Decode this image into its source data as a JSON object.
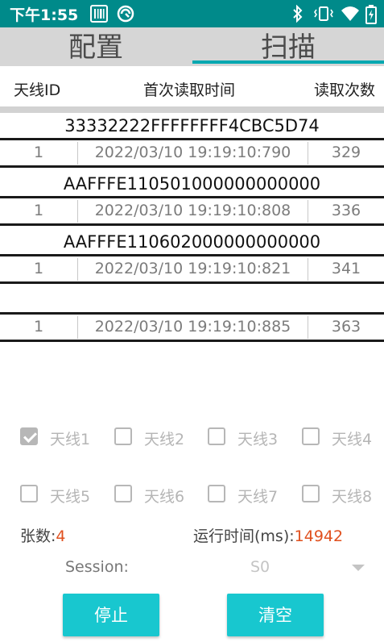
{
  "status_bar": {
    "time": "下午1:55",
    "left_icons": [
      "barcode-icon",
      "scan-app-icon"
    ],
    "right_icons": [
      "bluetooth-icon",
      "vibrate-icon",
      "wifi-icon",
      "battery-icon"
    ],
    "background": "#008a8a"
  },
  "tabs": [
    {
      "label": "配置",
      "selected": false
    },
    {
      "label": "扫描",
      "selected": true
    }
  ],
  "accent_color": "#00a8b0",
  "table_header": {
    "antenna_id": "天线ID",
    "first_read_time": "首次读取时间",
    "read_count": "读取次数"
  },
  "tags": [
    {
      "epc": "33332222FFFFFFFF4CBC5D74",
      "antenna": "1",
      "time": "2022/03/10 19:19:10:790",
      "count": "329"
    },
    {
      "epc": "AAFFFE110501000000000000",
      "antenna": "1",
      "time": "2022/03/10 19:19:10:808",
      "count": "336"
    },
    {
      "epc": "AAFFFE110602000000000000",
      "antenna": "1",
      "time": "2022/03/10 19:19:10:821",
      "count": "341"
    },
    {
      "epc": "",
      "antenna": "1",
      "time": "2022/03/10 19:19:10:885",
      "count": "363"
    }
  ],
  "antennas": [
    {
      "label": "天线1",
      "checked": true
    },
    {
      "label": "天线2",
      "checked": false
    },
    {
      "label": "天线3",
      "checked": false
    },
    {
      "label": "天线4",
      "checked": false
    },
    {
      "label": "天线5",
      "checked": false
    },
    {
      "label": "天线6",
      "checked": false
    },
    {
      "label": "天线7",
      "checked": false
    },
    {
      "label": "天线8",
      "checked": false
    }
  ],
  "stats": {
    "count_label": "张数:",
    "count_value": "4",
    "runtime_label": "运行时间(ms):",
    "runtime_value": "14942",
    "value_color": "#e0501e"
  },
  "session": {
    "label": "Session:",
    "value": "S0"
  },
  "buttons": {
    "stop": "停止",
    "clear": "清空",
    "color": "#18c7cf"
  }
}
